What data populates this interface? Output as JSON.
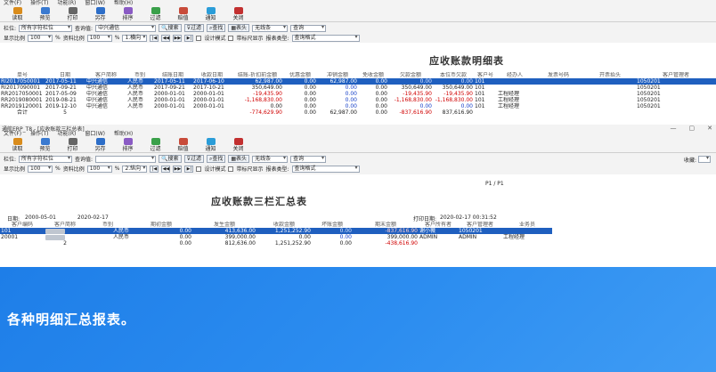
{
  "win1": {
    "menus": [
      "文件(F)",
      "操作(T)",
      "功能(R)",
      "窗口(W)",
      "帮助(H)"
    ],
    "toolbar": [
      {
        "label": "读取",
        "icon": "read-icon",
        "color": "#d98c1c"
      },
      {
        "label": "预览",
        "icon": "preview-icon",
        "color": "#3a7ad0"
      },
      {
        "label": "打印",
        "icon": "print-icon",
        "color": "#666666"
      },
      {
        "label": "另存",
        "icon": "save-as-icon",
        "color": "#2d6ec8"
      },
      {
        "label": "排序",
        "icon": "sort-icon",
        "color": "#8a5bc4"
      },
      {
        "label": "过滤",
        "icon": "filter-icon",
        "color": "#3aa04a"
      },
      {
        "label": "赔值",
        "icon": "value-icon",
        "color": "#c84b3a"
      },
      {
        "label": "通知",
        "icon": "notify-icon",
        "color": "#2b9dd8"
      },
      {
        "label": "关闭",
        "icon": "close-icon",
        "color": "#c23030"
      }
    ],
    "filter": {
      "col_label": "栏位:",
      "col_value": "所有字符栏位",
      "query_label": "查询值:",
      "query_value": "中兴通信",
      "search_btn": "搜索",
      "filter_btn": "过滤",
      "find_btn": "查找",
      "table_btn": "表头",
      "none_value": "无线条",
      "query_btn": "查询"
    },
    "display": {
      "scale_label": "显示比例",
      "scale_value": "100",
      "pct": "%",
      "data_scale_label": "资料比例",
      "data_scale_value": "100",
      "orient_value": "1.横向",
      "design_mode": "设计模式",
      "ruler": "带标尺显示",
      "report_type_label": "报表类型:",
      "report_type_value": "查询格式"
    },
    "report_title": "应收账款明细表",
    "headers": [
      "单号",
      "日期",
      "客户简称",
      "币别",
      "结账日期",
      "收款日期",
      "结账-折扣前金额",
      "优惠金额",
      "冲销金额",
      "免收金额",
      "欠款金额",
      "本位币欠款",
      "客户号",
      "经办人",
      "发票号码",
      "开票抬头",
      "客户管理者"
    ],
    "rows": [
      [
        "RI2017050001",
        "2017-05-11",
        "中兴通信",
        "人民币",
        "2017-05-11",
        "2017-06-10",
        "62,987.00",
        "0.00",
        "62,987.00",
        "0.00",
        "0.00",
        "0.00",
        "101",
        "",
        "",
        "",
        "1050201"
      ],
      [
        "RI2017090001",
        "2017-09-21",
        "中兴通信",
        "人民币",
        "2017-09-21",
        "2017-10-21",
        "350,649.00",
        "0.00",
        "0.00",
        "0.00",
        "350,649.00",
        "350,649.00",
        "101",
        "",
        "",
        "",
        "1050201"
      ],
      [
        "RR2017050001",
        "2017-05-09",
        "中兴通信",
        "人民币",
        "2000-01-01",
        "2000-01-01",
        "-19,435.90",
        "0.00",
        "0.00",
        "0.00",
        "-19,435.90",
        "-19,435.90",
        "101",
        "工程经理",
        "",
        "",
        "1050201"
      ],
      [
        "RR2019080001",
        "2019-08-21",
        "中兴通信",
        "人民币",
        "2000-01-01",
        "2000-01-01",
        "-1,168,830.00",
        "0.00",
        "0.00",
        "0.00",
        "-1,168,830.00",
        "-1,168,830.00",
        "101",
        "工程经理",
        "",
        "",
        "1050201"
      ],
      [
        "RR2019120001",
        "2019-12-10",
        "中兴通信",
        "人民币",
        "2000-01-01",
        "2000-01-01",
        "0.00",
        "0.00",
        "0.00",
        "0.00",
        "0.00",
        "0.00",
        "101",
        "工程经理",
        "",
        "",
        "1050201"
      ]
    ],
    "total": {
      "label": "合计",
      "count": "5",
      "amount": "-774,629.90",
      "discount": "0.00",
      "writeoff": "62,987.00",
      "free": "0.00",
      "owed": "-837,616.90",
      "owed_base": "837,616.90"
    }
  },
  "win2": {
    "title": "通航ERP_T8 - [应收账款三栏总表]",
    "controls": [
      "—",
      "▢",
      "✕"
    ],
    "menus": [
      "文件(F)",
      "操作(T)",
      "功能(R)",
      "窗口(W)",
      "帮助(H)"
    ],
    "filter": {
      "col_label": "栏位:",
      "col_value": "所有字符栏位",
      "query_label": "查询值:",
      "query_value": "",
      "search_btn": "搜索",
      "filter_btn": "过滤",
      "find_btn": "查找",
      "table_btn": "表头",
      "none_value": "无线条",
      "query_btn": "查询",
      "collect_label": "收藏:"
    },
    "display": {
      "scale_label": "显示比例",
      "scale_value": "100",
      "pct": "%",
      "data_scale_label": "资料比例",
      "data_scale_value": "100",
      "orient_value": "2.纵向",
      "design_mode": "设计模式",
      "ruler": "带标尺显示",
      "report_type_label": "报表类型:",
      "report_type_value": "查询格式"
    },
    "page": "P1 / P1",
    "report_title": "应收账款三栏汇总表",
    "date_label": "日期:",
    "date_from": "2000-05-01",
    "date_to": "2020-02-17",
    "print_date_label": "打印日期:",
    "print_date": "2020-02-17 00:31:52",
    "headers": [
      "客户编码",
      "客户简称",
      "币别",
      "期初金额",
      "发生金额",
      "收款金额",
      "坏账金额",
      "期末金额",
      "客户所有者",
      "客户管理者",
      "业务员"
    ],
    "rows": [
      [
        "101",
        "",
        "人民币",
        "0.00",
        "413,636.00",
        "1,251,252.90",
        "0.00",
        "-837,616.90",
        "谢小薇",
        "1050201",
        ""
      ],
      [
        "20001",
        "",
        "人民币",
        "0.00",
        "399,000.00",
        "0.00",
        "0.00",
        "399,000.00",
        "ADMIN",
        "ADMIN",
        "工程经理"
      ],
      [
        "",
        "2",
        "",
        "0.00",
        "812,636.00",
        "1,251,252.90",
        "0.00",
        "-438,616.90",
        "",
        "",
        ""
      ]
    ]
  },
  "banner": {
    "text": "各种明细汇总报表。"
  }
}
